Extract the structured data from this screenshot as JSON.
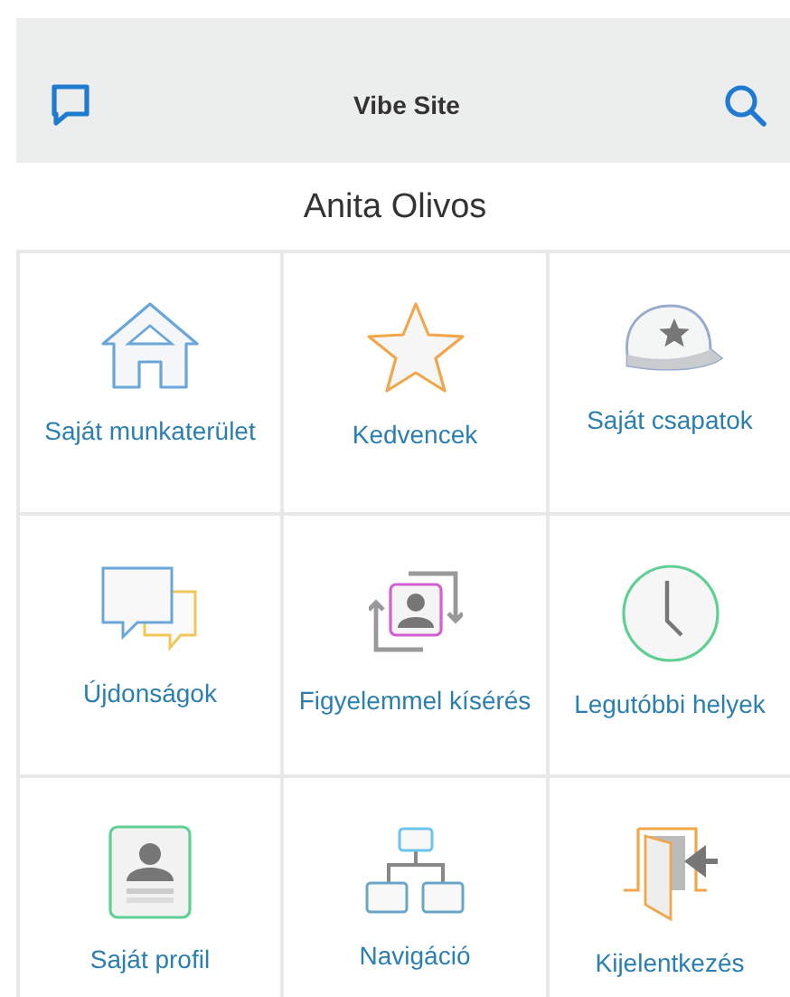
{
  "header": {
    "title": "Vibe Site"
  },
  "user": {
    "name": "Anita Olivos"
  },
  "tiles": [
    {
      "kind": "home",
      "label": "Saját munkaterület"
    },
    {
      "kind": "star",
      "label": "Kedvencek"
    },
    {
      "kind": "cap",
      "label": "Saját csapatok"
    },
    {
      "kind": "chat",
      "label": "Újdonságok"
    },
    {
      "kind": "follow",
      "label": "Figyelemmel kísérés"
    },
    {
      "kind": "clock",
      "label": "Legutóbbi helyek"
    },
    {
      "kind": "profile",
      "label": "Saját profil"
    },
    {
      "kind": "tree",
      "label": "Navigáció"
    },
    {
      "kind": "logout",
      "label": "Kijelentkezés"
    }
  ]
}
